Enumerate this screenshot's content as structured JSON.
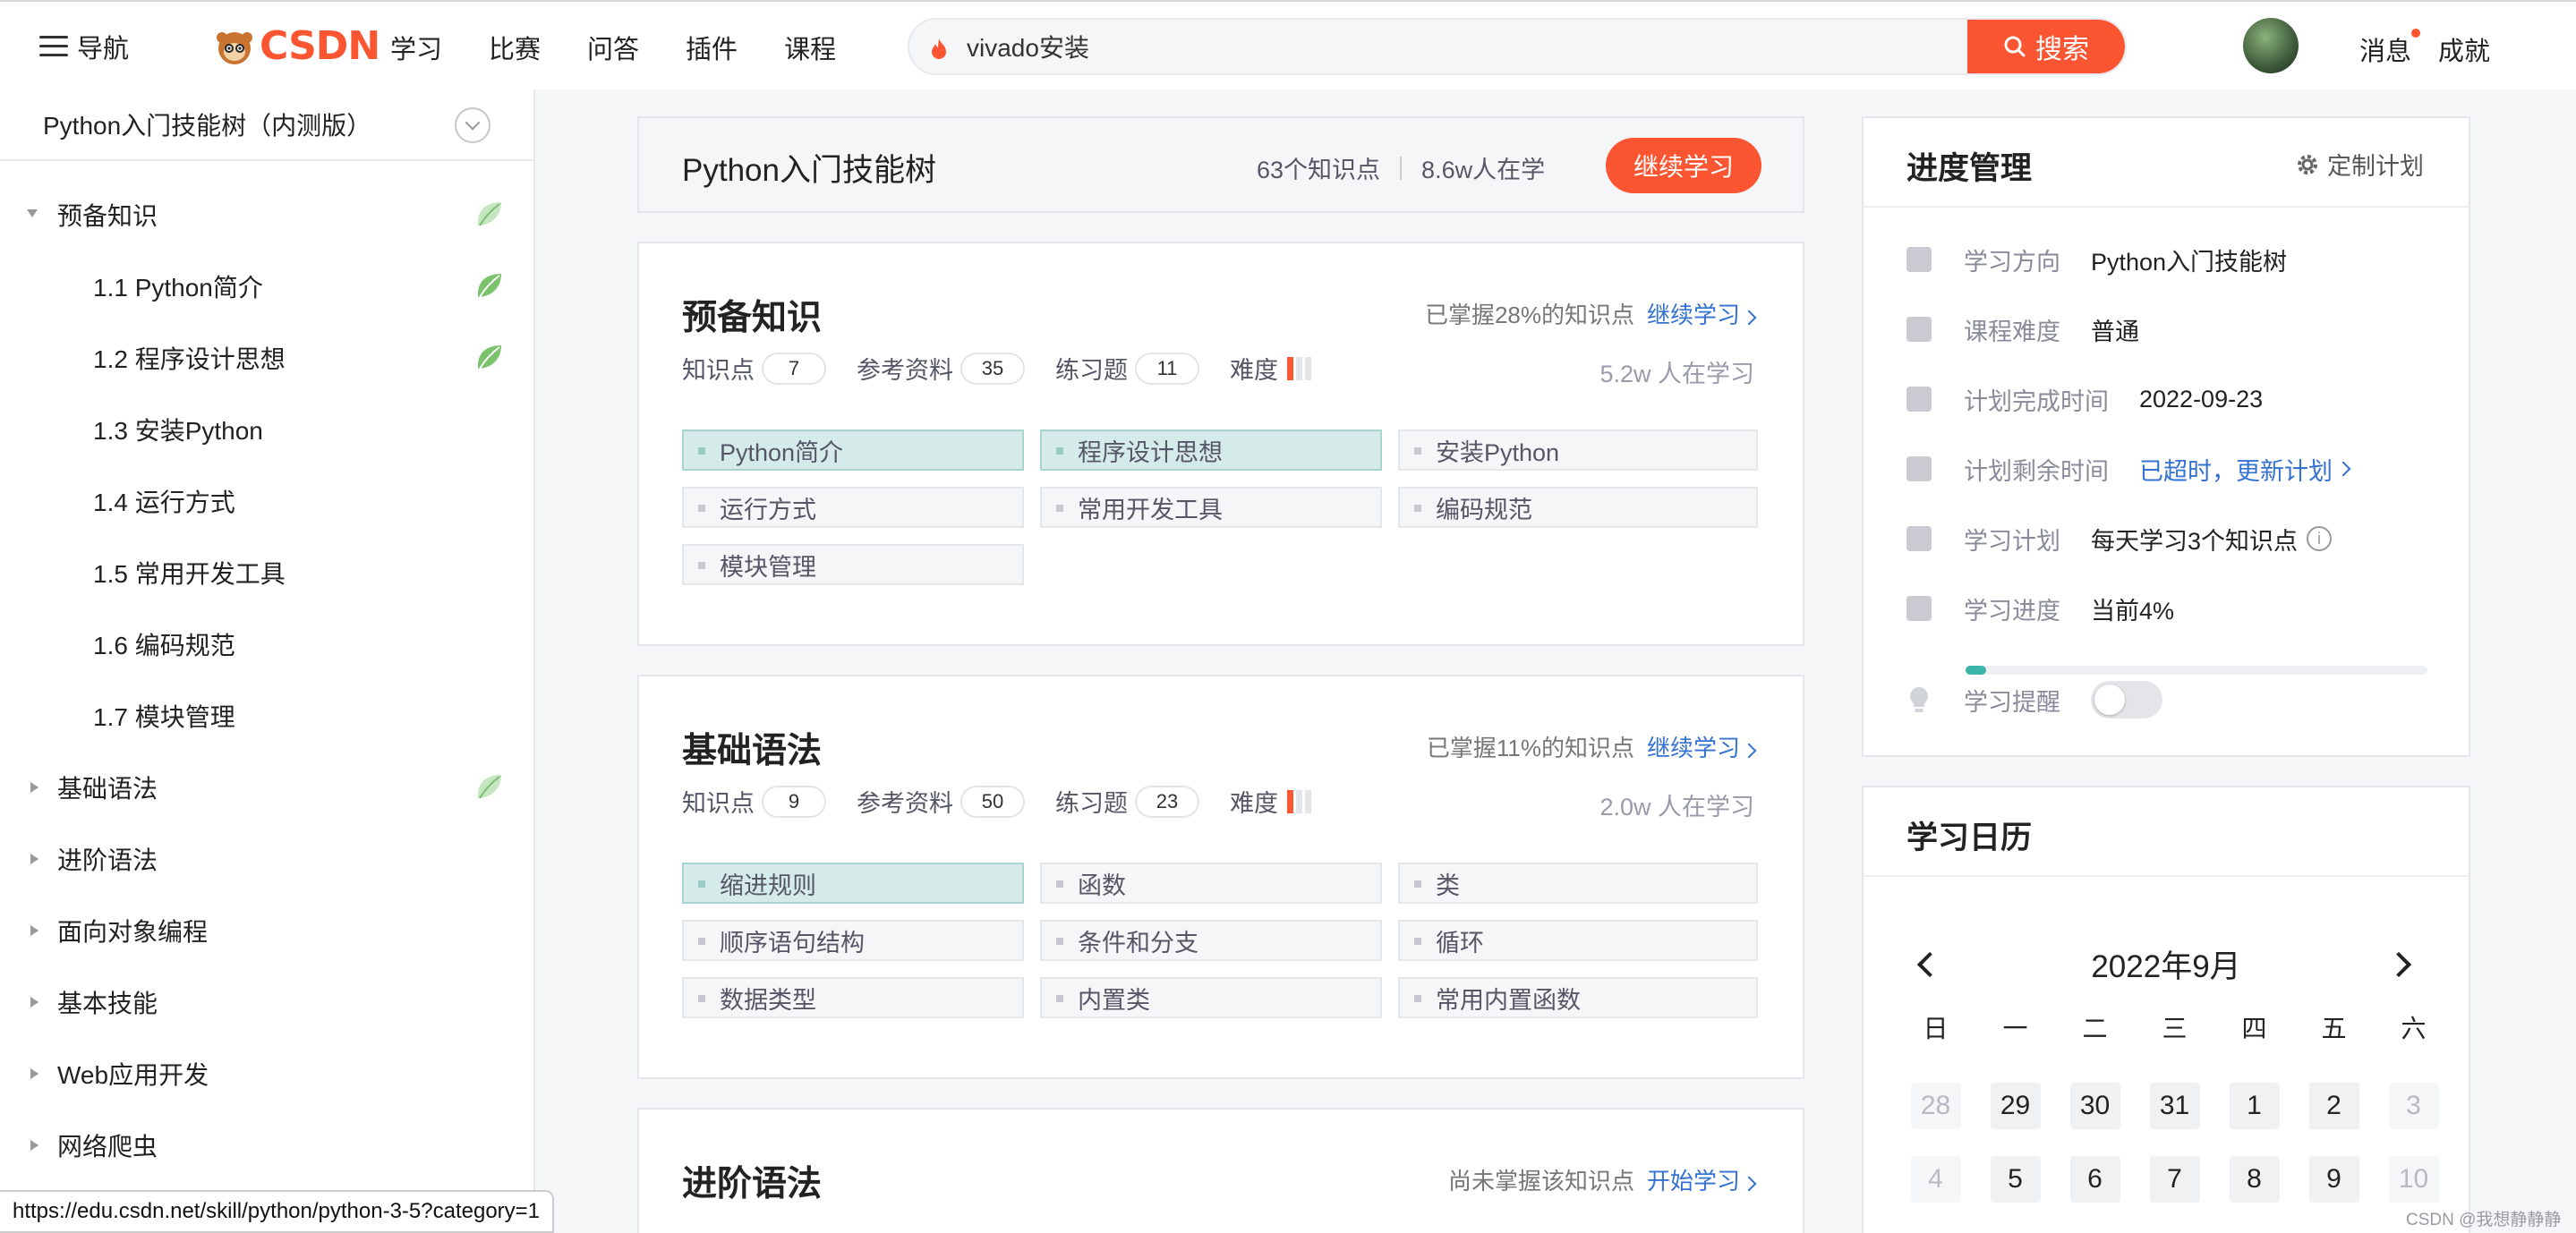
{
  "topnav": {
    "menu_label": "导航",
    "logo_text": "CSDN",
    "links": [
      "学习",
      "比赛",
      "问答",
      "插件",
      "课程"
    ],
    "search_value": "vivado安装",
    "search_button": "搜索",
    "messages": "消息",
    "achievements": "成就"
  },
  "sidebar": {
    "header": "Python入门技能树（内测版）",
    "items": [
      {
        "label": "预备知识"
      },
      {
        "label": "1.1 Python简介"
      },
      {
        "label": "1.2 程序设计思想"
      },
      {
        "label": "1.3 安装Python"
      },
      {
        "label": "1.4 运行方式"
      },
      {
        "label": "1.5 常用开发工具"
      },
      {
        "label": "1.6 编码规范"
      },
      {
        "label": "1.7 模块管理"
      },
      {
        "label": "基础语法"
      },
      {
        "label": "进阶语法"
      },
      {
        "label": "面向对象编程"
      },
      {
        "label": "基本技能"
      },
      {
        "label": "Web应用开发"
      },
      {
        "label": "网络爬虫"
      }
    ]
  },
  "status_url": "https://edu.csdn.net/skill/python/python-3-5?category=1",
  "hero": {
    "title": "Python入门技能树",
    "points": "63个知识点",
    "learners": "8.6w人在学",
    "continue": "继续学习"
  },
  "labels": {
    "points": "知识点",
    "refs": "参考资料",
    "exercises": "练习题",
    "difficulty": "难度"
  },
  "sections": [
    {
      "title": "预备知识",
      "status": "已掌握28%的知识点",
      "action": "继续学习",
      "points": "7",
      "refs": "35",
      "exercises": "11",
      "learners": "5.2w 人在学习",
      "tags": [
        "Python简介",
        "程序设计思想",
        "安装Python",
        "运行方式",
        "常用开发工具",
        "编码规范",
        "模块管理"
      ]
    },
    {
      "title": "基础语法",
      "status": "已掌握11%的知识点",
      "action": "继续学习",
      "points": "9",
      "refs": "50",
      "exercises": "23",
      "learners": "2.0w 人在学习",
      "tags": [
        "缩进规则",
        "函数",
        "类",
        "顺序语句结构",
        "条件和分支",
        "循环",
        "数据类型",
        "内置类",
        "常用内置函数"
      ]
    },
    {
      "title": "进阶语法",
      "status": "尚未掌握该知识点",
      "action": "开始学习"
    }
  ],
  "progress_panel": {
    "title": "进度管理",
    "custom_plan": "定制计划",
    "rows": [
      {
        "key": "学习方向",
        "value": "Python入门技能树"
      },
      {
        "key": "课程难度",
        "value": "普通"
      },
      {
        "key": "计划完成时间",
        "value": "2022-09-23"
      },
      {
        "key": "计划剩余时间",
        "value": "已超时，更新计划"
      },
      {
        "key": "学习计划",
        "value": "每天学习3个知识点"
      },
      {
        "key": "学习进度",
        "value": "当前4%"
      },
      {
        "key": "学习提醒",
        "value": ""
      }
    ],
    "progress_fraction": 0.04
  },
  "calendar": {
    "title": "学习日历",
    "month": "2022年9月",
    "weekdays": [
      "日",
      "一",
      "二",
      "三",
      "四",
      "五",
      "六"
    ],
    "days": [
      "28",
      "29",
      "30",
      "31",
      "1",
      "2",
      "3",
      "4",
      "5",
      "6",
      "7",
      "8",
      "9",
      "10"
    ]
  },
  "watermark": "CSDN @我想静静静",
  "colors": {
    "brand": "#fc5531",
    "link": "#3471d1",
    "mastered_tag": "#d5ebe9",
    "progress": "#3bb5a8"
  }
}
